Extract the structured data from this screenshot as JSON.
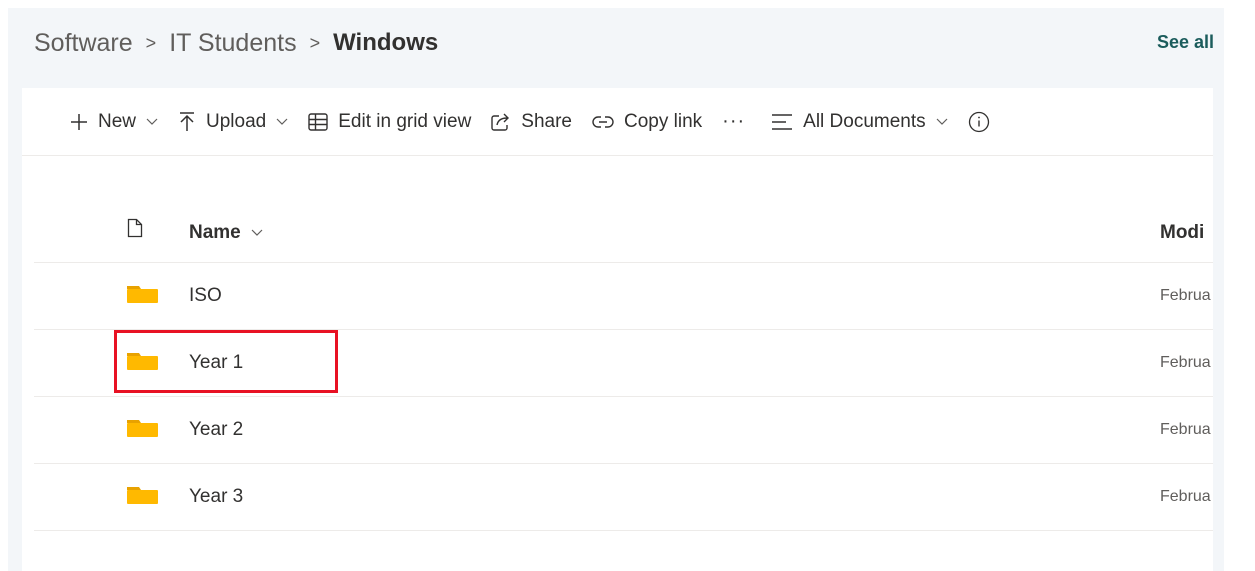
{
  "breadcrumb": {
    "items": [
      "Software",
      "IT Students"
    ],
    "separator": ">",
    "current": "Windows"
  },
  "see_all_label": "See all",
  "toolbar": {
    "new_label": "New",
    "upload_label": "Upload",
    "edit_grid_label": "Edit in grid view",
    "share_label": "Share",
    "copy_link_label": "Copy link",
    "more_label": "···",
    "view_label": "All Documents"
  },
  "columns": {
    "name": "Name",
    "modified": "Modi"
  },
  "files": [
    {
      "name": "ISO",
      "modified": "Februa",
      "icon": "folder-icon"
    },
    {
      "name": "Year 1",
      "modified": "Februa",
      "icon": "folder-icon",
      "highlighted": true
    },
    {
      "name": "Year 2",
      "modified": "Februa",
      "icon": "folder-icon"
    },
    {
      "name": "Year 3",
      "modified": "Februa",
      "icon": "folder-icon"
    }
  ],
  "colors": {
    "accent": "#1b5c5c",
    "folder": "#ffb900",
    "highlight": "#e81123",
    "background": "#f3f6f9"
  }
}
